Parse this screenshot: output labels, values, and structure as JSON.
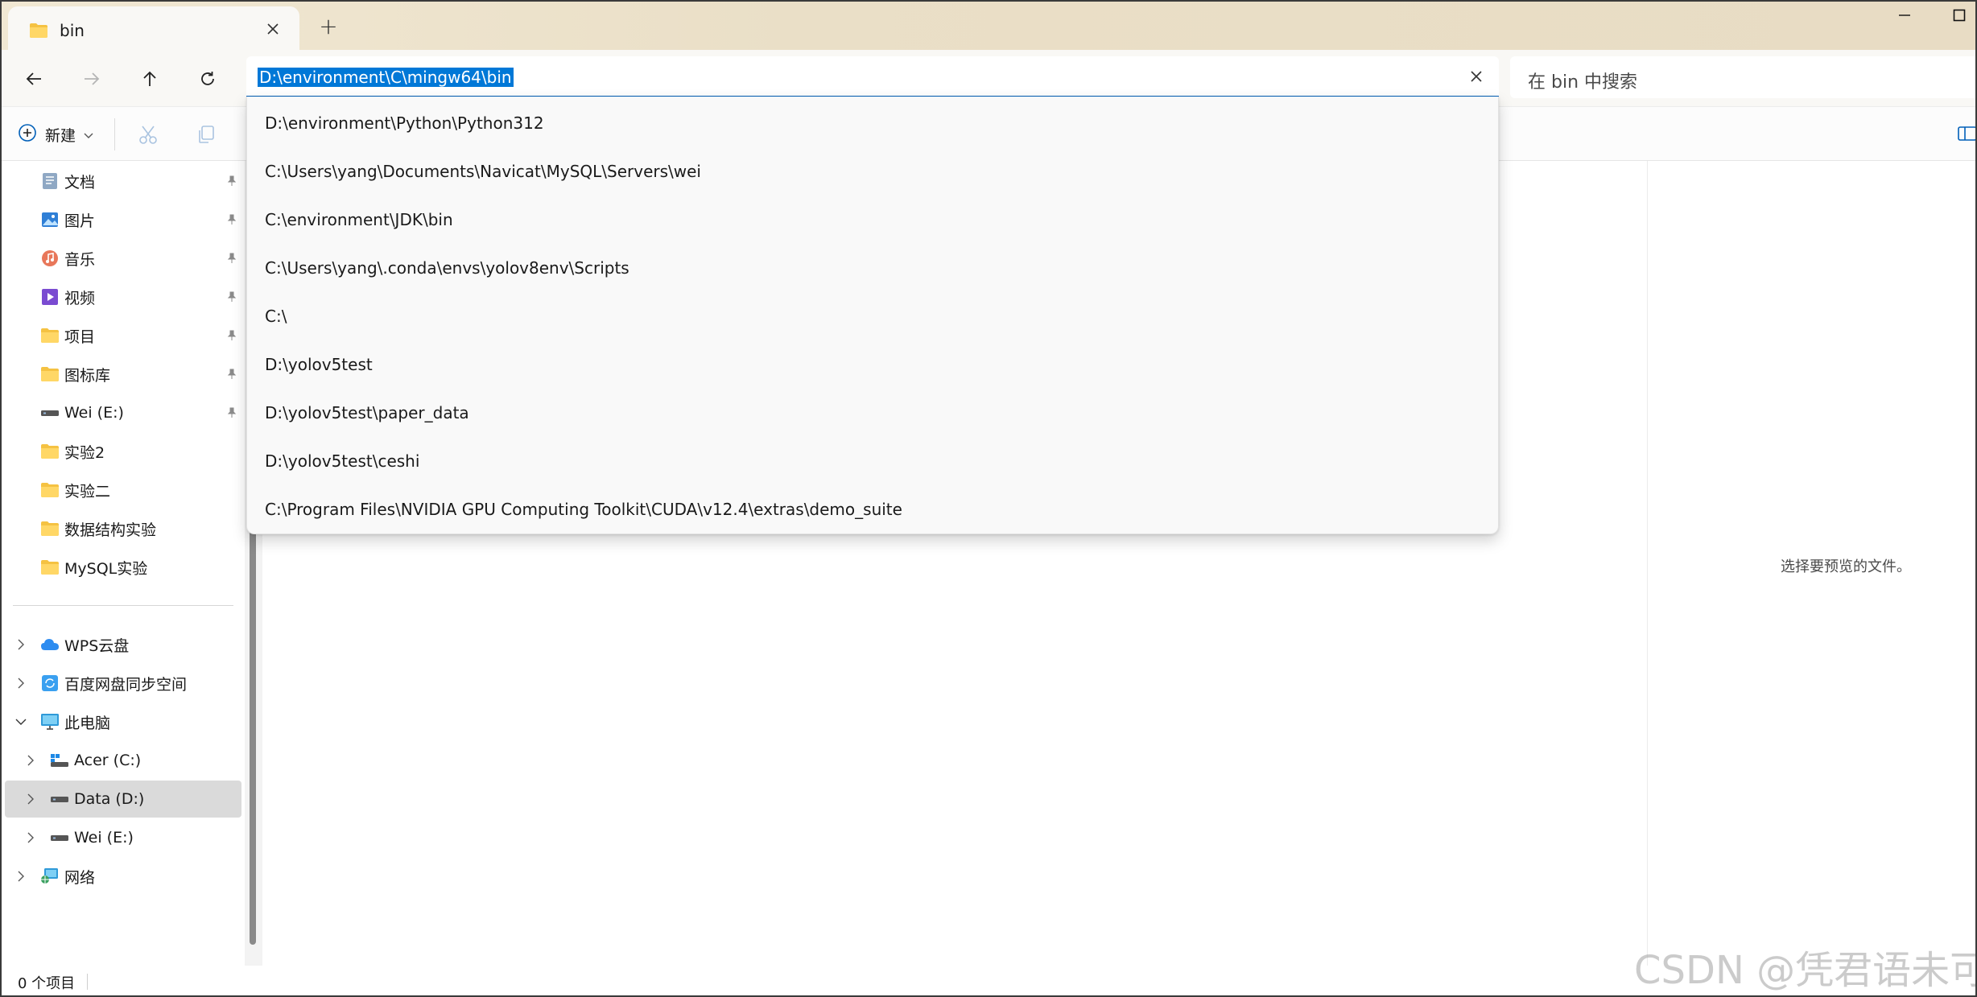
{
  "tab": {
    "title": "bin",
    "folder_icon": "folder-icon",
    "close_icon": "close-icon"
  },
  "window": {
    "new_tab_glyph": "+",
    "minimize_icon": "minimize-icon",
    "maximize_icon": "maximize-icon"
  },
  "nav": {
    "back_icon": "arrow-left-icon",
    "forward_icon": "arrow-right-icon",
    "up_icon": "arrow-up-icon",
    "refresh_icon": "refresh-icon",
    "address_value": "D:\\environment\\C\\mingw64\\bin",
    "search_placeholder": "在 bin 中搜索"
  },
  "toolbar": {
    "new_label": "新建"
  },
  "address_suggestions": [
    "D:\\environment\\Python\\Python312",
    "C:\\Users\\yang\\Documents\\Navicat\\MySQL\\Servers\\wei",
    "C:\\environment\\JDK\\bin",
    "C:\\Users\\yang\\.conda\\envs\\yolov8env\\Scripts",
    "C:\\",
    "D:\\yolov5test",
    "D:\\yolov5test\\paper_data",
    "D:\\yolov5test\\ceshi",
    "C:\\Program Files\\NVIDIA GPU Computing Toolkit\\CUDA\\v12.4\\extras\\demo_suite"
  ],
  "sidebar": {
    "quick_access": [
      {
        "label": "文档",
        "icon": "documents-icon",
        "pinned": true
      },
      {
        "label": "图片",
        "icon": "pictures-icon",
        "pinned": true
      },
      {
        "label": "音乐",
        "icon": "music-icon",
        "pinned": true
      },
      {
        "label": "视频",
        "icon": "videos-icon",
        "pinned": true
      },
      {
        "label": "项目",
        "icon": "folder-icon",
        "pinned": true
      },
      {
        "label": "图标库",
        "icon": "folder-icon",
        "pinned": true
      },
      {
        "label": "Wei (E:)",
        "icon": "drive-icon",
        "pinned": true
      },
      {
        "label": "实验2",
        "icon": "folder-icon",
        "pinned": false
      },
      {
        "label": "实验二",
        "icon": "folder-icon",
        "pinned": false
      },
      {
        "label": "数据结构实验",
        "icon": "folder-icon",
        "pinned": false
      },
      {
        "label": "MySQL实验",
        "icon": "folder-icon",
        "pinned": false
      }
    ],
    "tree": [
      {
        "label": "WPS云盘",
        "icon": "cloud-icon",
        "expanded": false
      },
      {
        "label": "百度网盘同步空间",
        "icon": "sync-folder-icon",
        "expanded": false
      },
      {
        "label": "此电脑",
        "icon": "computer-icon",
        "expanded": true
      },
      {
        "label": "Acer (C:)",
        "icon": "windows-drive-icon",
        "expanded": false
      },
      {
        "label": "Data (D:)",
        "icon": "drive-icon",
        "expanded": false,
        "selected": true
      },
      {
        "label": "Wei (E:)",
        "icon": "drive-icon",
        "expanded": false
      },
      {
        "label": "网络",
        "icon": "network-icon",
        "expanded": false
      }
    ]
  },
  "preview": {
    "empty_text": "选择要预览的文件。"
  },
  "status": {
    "item_count": "0 个项目"
  },
  "watermark": "CSDN @凭君语未可",
  "colors": {
    "accent": "#005fb8",
    "selection": "#0078d7",
    "titlebar": "#eadfc7"
  }
}
